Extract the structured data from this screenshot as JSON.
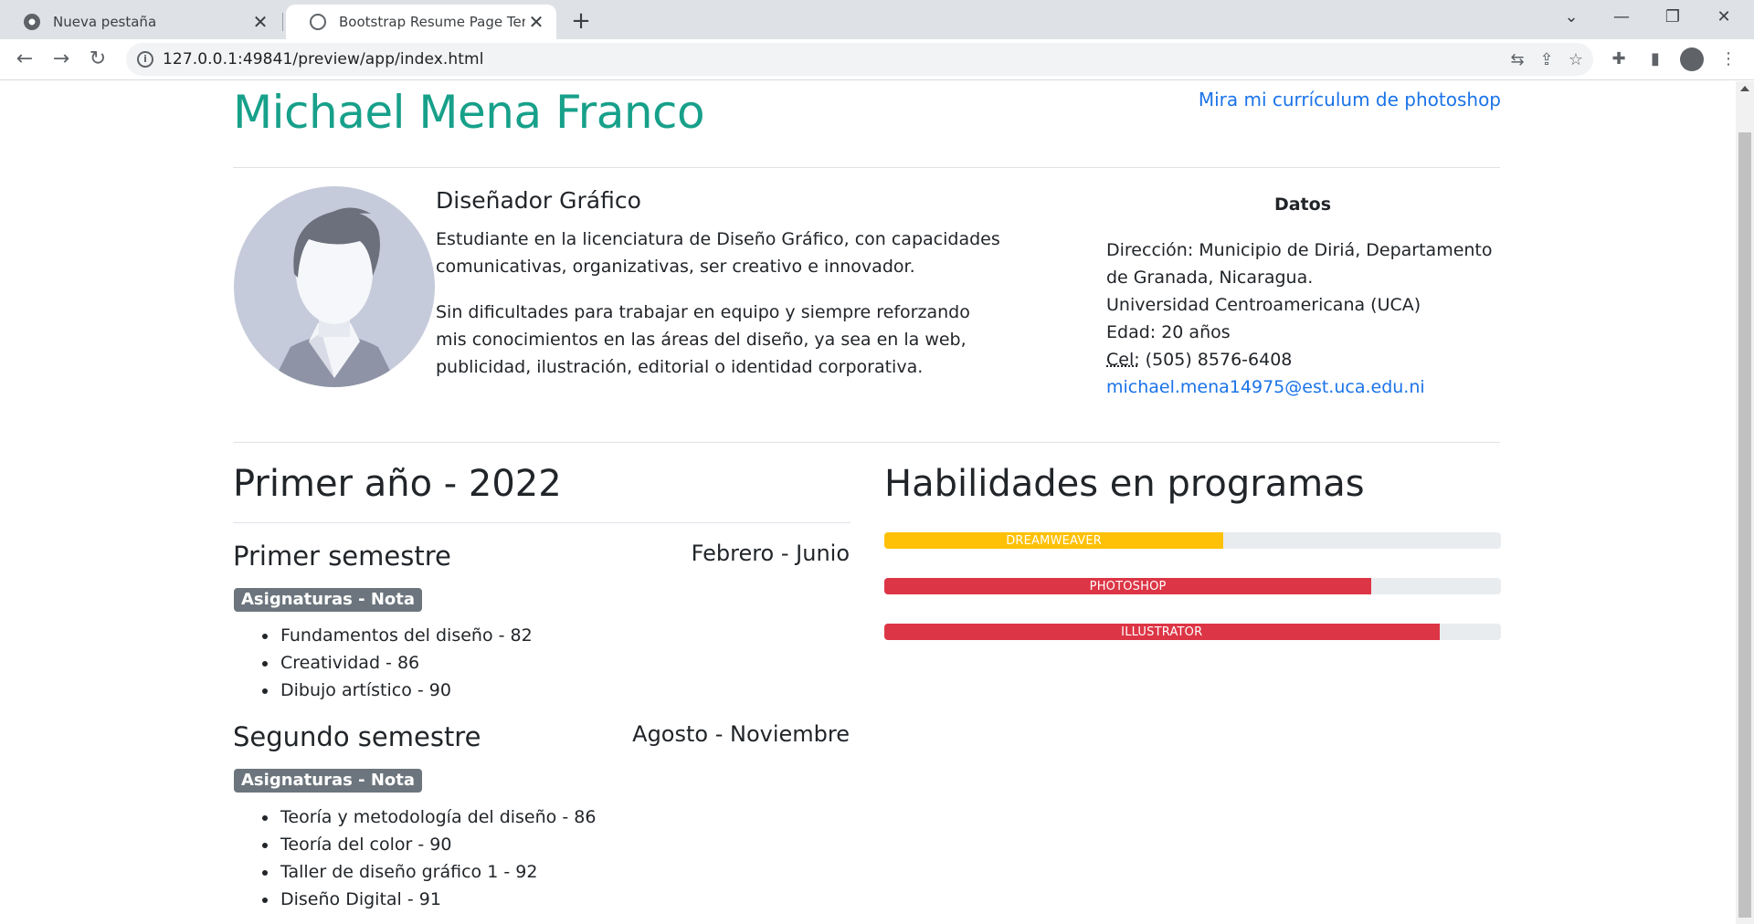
{
  "browser": {
    "tabs": [
      {
        "label": "Nueva pestaña"
      },
      {
        "label": "Bootstrap Resume Page Template"
      }
    ],
    "url": "127.0.0.1:49841/preview/app/index.html"
  },
  "header": {
    "name": "Michael Mena Franco",
    "photoshop_link": "Mira mi currículum de photoshop"
  },
  "profile": {
    "role": "Diseñador Gráfico",
    "paragraph1": "Estudiante en la licenciatura de Diseño Gráfico, con capacidades comunicativas, organizativas, ser creativo e innovador.",
    "paragraph2": "Sin dificultades para trabajar en equipo y siempre reforzando mis conocimientos en las áreas del diseño, ya sea en la web, publicidad, ilustración, editorial o identidad corporativa."
  },
  "datos": {
    "title": "Datos",
    "address": "Dirección: Municipio de Diriá,  Departamento de Granada, Nicaragua.",
    "university": "Universidad Centroamericana (UCA)",
    "age": "Edad: 20 años",
    "phone_label": "Cel:",
    "phone": " (505) 8576-6408",
    "email": "michael.mena14975@est.uca.edu.ni"
  },
  "year": {
    "title": "Primer año - 2022",
    "semesters": [
      {
        "title": "Primer semestre",
        "range": "Febrero - Junio",
        "badge": "Asignaturas - Nota",
        "subjects": [
          "Fundamentos del diseño - 82",
          "Creatividad - 86",
          "Dibujo artístico - 90"
        ]
      },
      {
        "title": "Segundo semestre",
        "range": "Agosto - Noviembre",
        "badge": "Asignaturas - Nota",
        "subjects": [
          "Teoría y metodología del diseño - 86",
          "Teoría del color - 90",
          "Taller de diseño gráfico 1 - 92",
          "Diseño Digital - 91"
        ]
      }
    ]
  },
  "skills": {
    "title": "Habilidades en programas",
    "items": [
      {
        "label": "DREAMWEAVER",
        "percent": 55,
        "color": "#ffc107"
      },
      {
        "label": "PHOTOSHOP",
        "percent": 79,
        "color": "#dc3545"
      },
      {
        "label": "ILLUSTRATOR",
        "percent": 90,
        "color": "#dc3545"
      }
    ]
  }
}
